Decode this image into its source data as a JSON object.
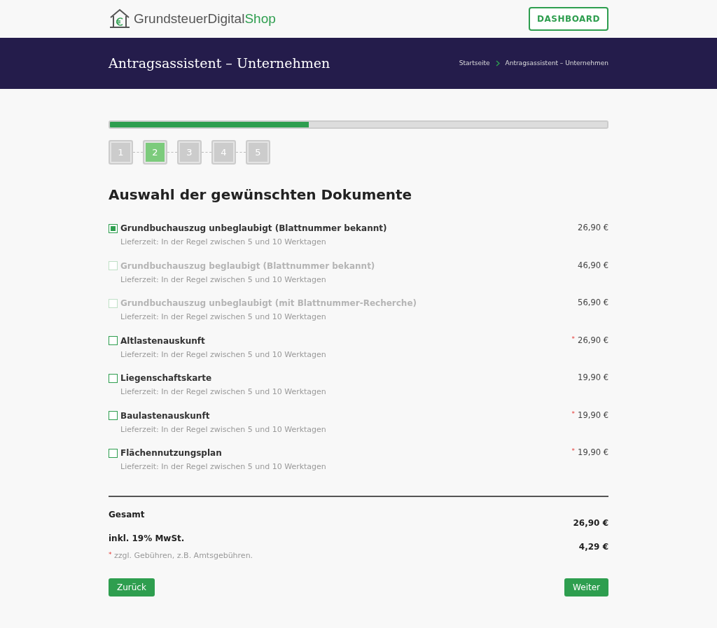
{
  "header": {
    "logo": {
      "name": "GrundsteuerDigital",
      "suffix": "Shop"
    },
    "dashboard_button": "DASHBOARD"
  },
  "banner": {
    "title": "Antragsassistent – Unternehmen",
    "breadcrumb": [
      "Startseite",
      "Antragsassistent – Unternehmen"
    ]
  },
  "progress": {
    "level": 0.4
  },
  "steps": [
    {
      "label": "1",
      "selected": false
    },
    {
      "label": "2",
      "selected": true
    },
    {
      "label": "3",
      "selected": false
    },
    {
      "label": "4",
      "selected": false
    },
    {
      "label": "5",
      "selected": false
    }
  ],
  "heading": "Auswahl der gewünschten Dokumente",
  "documents": [
    {
      "title": "Grundbuchauszug unbeglaubigt (Blattnummer bekannt)",
      "delivery": "Lieferzeit: In der Regel zwischen 5 und 10 Werktagen",
      "price": "26,90 €",
      "checked": true,
      "disabled": false
    },
    {
      "title": "Grundbuchauszug beglaubigt (Blattnummer bekannt)",
      "delivery": "Lieferzeit: In der Regel zwischen 5 und 10 Werktagen",
      "price": "46,90 €",
      "checked": false,
      "disabled": true
    },
    {
      "title": "Grundbuchauszug unbeglaubigt (mit Blattnummer-Recherche)",
      "delivery": "Lieferzeit: In der Regel zwischen 5 und 10 Werktagen",
      "price": "56,90 €",
      "checked": false,
      "disabled": true
    },
    {
      "title": "Altlastenauskunft",
      "delivery": "Lieferzeit: In der Regel zwischen 5 und 10 Werktagen",
      "price": "26,90 €",
      "marker": "*",
      "checked": false,
      "disabled": false
    },
    {
      "title": "Liegenschaftskarte",
      "delivery": "Lieferzeit: In der Regel zwischen 5 und 10 Werktagen",
      "price": "19,90 €",
      "checked": false,
      "disabled": false
    },
    {
      "title": "Baulastenauskunft",
      "delivery": "Lieferzeit: In der Regel zwischen 5 und 10 Werktagen",
      "price": "19,90 €",
      "marker": "*",
      "checked": false,
      "disabled": false
    },
    {
      "title": "Flächennutzungsplan",
      "delivery": "Lieferzeit: In der Regel zwischen 5 und 10 Werktagen",
      "price": "19,90 €",
      "marker": "*",
      "checked": false,
      "disabled": false
    }
  ],
  "summary": {
    "total_label": "Gesamt",
    "total": "26,90 €",
    "vat_label": "inkl. 19% MwSt.",
    "vat": "4,29 €",
    "footnote_marker": "*",
    "footnote": "zzgl. Gebühren, z.B. Amtsgebühren."
  },
  "buttons": {
    "back": "Zurück",
    "next": "Weiter"
  }
}
